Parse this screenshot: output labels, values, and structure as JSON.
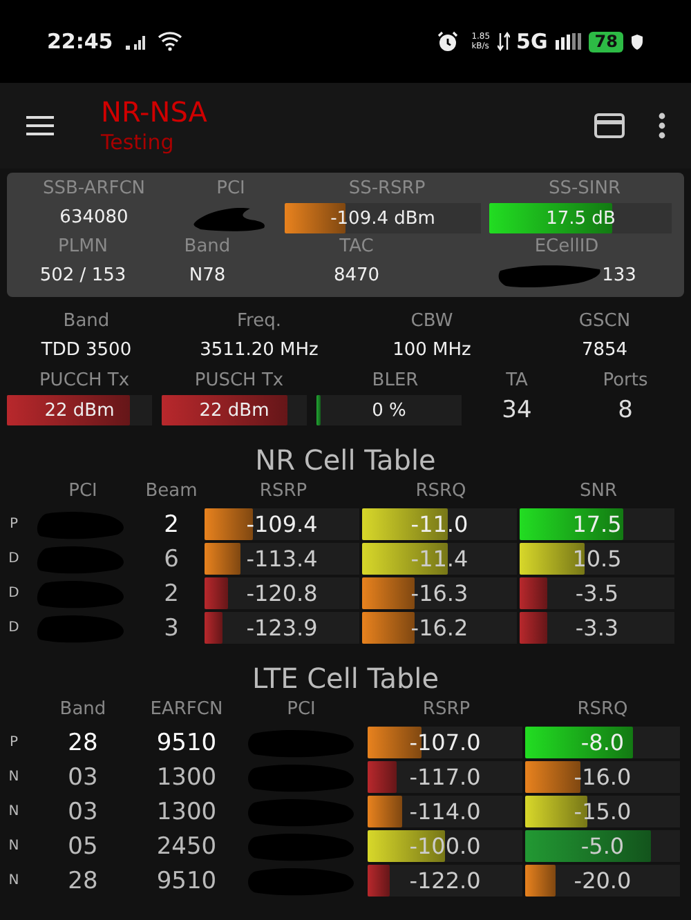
{
  "status_bar": {
    "time": "22:45",
    "net_speed": "1.85",
    "net_unit": "kB/s",
    "network": "5G",
    "battery": "78"
  },
  "app_bar": {
    "title": "NR-NSA",
    "subtitle": "Testing"
  },
  "serving_cell": {
    "row_1": [
      {
        "kind": "text",
        "label": "SSB-ARFCN",
        "value": "634080"
      },
      {
        "kind": "redacted",
        "label": "PCI"
      },
      {
        "kind": "bar",
        "label": "SS-RSRP",
        "value": "-109.4 dBm",
        "level": 0.31,
        "color": "#e8821e"
      },
      {
        "kind": "bar",
        "label": "SS-SINR",
        "value": "17.5 dB",
        "level": 0.67,
        "color": "#22dd22"
      }
    ],
    "row_2": [
      {
        "kind": "text",
        "label": "PLMN",
        "value": "502 / 153"
      },
      {
        "kind": "text",
        "label": "Band",
        "value": "N78"
      },
      {
        "kind": "text",
        "label": "TAC",
        "value": "8470"
      },
      {
        "kind": "partly_redacted",
        "label": "ECellID",
        "value": "133"
      }
    ]
  },
  "carrier": [
    {
      "label": "Band",
      "value": "TDD 3500"
    },
    {
      "label": "Freq.",
      "value": "3511.20 MHz"
    },
    {
      "label": "CBW",
      "value": "100 MHz"
    },
    {
      "label": "GSCN",
      "value": "7854"
    }
  ],
  "uplink": [
    {
      "kind": "bar",
      "label": "PUCCH Tx",
      "value": "22 dBm",
      "level": 0.85,
      "color": "#b8282c"
    },
    {
      "kind": "bar",
      "label": "PUSCH Tx",
      "value": "22 dBm",
      "level": 0.87,
      "color": "#b8282c"
    },
    {
      "kind": "bar",
      "label": "BLER",
      "value": "0 %",
      "level": 0.03,
      "color": "#22aa33"
    },
    {
      "kind": "text",
      "label": "TA",
      "value": "34"
    },
    {
      "kind": "text",
      "label": "Ports",
      "value": "8"
    }
  ],
  "nr_table": {
    "title": "NR Cell Table",
    "columns": [
      "PCI",
      "Beam",
      "RSRP",
      "RSRQ",
      "SNR"
    ],
    "rows": [
      {
        "type": "P",
        "primary": true,
        "pci_redacted": true,
        "beam": "2",
        "bars": [
          {
            "value": "-109.4",
            "level": 0.31,
            "color": "#e8821e"
          },
          {
            "value": "-11.0",
            "level": 0.55,
            "color": "#d8d82a"
          },
          {
            "value": "17.5",
            "level": 0.67,
            "color": "#22dd22"
          }
        ]
      },
      {
        "type": "D",
        "primary": false,
        "pci_redacted": true,
        "beam": "6",
        "bars": [
          {
            "value": "-113.4",
            "level": 0.23,
            "color": "#e8821e"
          },
          {
            "value": "-11.4",
            "level": 0.55,
            "color": "#d8d82a"
          },
          {
            "value": "10.5",
            "level": 0.42,
            "color": "#d8d82a"
          }
        ]
      },
      {
        "type": "D",
        "primary": false,
        "pci_redacted": true,
        "beam": "2",
        "bars": [
          {
            "value": "-120.8",
            "level": 0.15,
            "color": "#b8282c"
          },
          {
            "value": "-16.3",
            "level": 0.34,
            "color": "#e8821e"
          },
          {
            "value": "-3.5",
            "level": 0.18,
            "color": "#b8282c"
          }
        ]
      },
      {
        "type": "D",
        "primary": false,
        "pci_redacted": true,
        "beam": "3",
        "bars": [
          {
            "value": "-123.9",
            "level": 0.12,
            "color": "#b8282c"
          },
          {
            "value": "-16.2",
            "level": 0.34,
            "color": "#e8821e"
          },
          {
            "value": "-3.3",
            "level": 0.18,
            "color": "#b8282c"
          }
        ]
      }
    ]
  },
  "lte_table": {
    "title": "LTE Cell Table",
    "columns": [
      "Band",
      "EARFCN",
      "PCI",
      "RSRP",
      "RSRQ"
    ],
    "rows": [
      {
        "type": "P",
        "primary": true,
        "band": "28",
        "earfcn": "9510",
        "pci_redacted": true,
        "bars": [
          {
            "value": "-107.0",
            "level": 0.35,
            "color": "#e8821e"
          },
          {
            "value": "-8.0",
            "level": 0.7,
            "color": "#22dd22"
          }
        ]
      },
      {
        "type": "N",
        "primary": false,
        "band": "03",
        "earfcn": "1300",
        "pci_redacted": true,
        "bars": [
          {
            "value": "-117.0",
            "level": 0.19,
            "color": "#b8282c"
          },
          {
            "value": "-16.0",
            "level": 0.36,
            "color": "#e8821e"
          }
        ]
      },
      {
        "type": "N",
        "primary": false,
        "band": "03",
        "earfcn": "1300",
        "pci_redacted": true,
        "bars": [
          {
            "value": "-114.0",
            "level": 0.22,
            "color": "#e8821e"
          },
          {
            "value": "-15.0",
            "level": 0.4,
            "color": "#d8d82a"
          }
        ]
      },
      {
        "type": "N",
        "primary": false,
        "band": "05",
        "earfcn": "2450",
        "pci_redacted": true,
        "bars": [
          {
            "value": "-100.0",
            "level": 0.5,
            "color": "#d8d82a"
          },
          {
            "value": "-5.0",
            "level": 0.81,
            "color": "#229933"
          }
        ]
      },
      {
        "type": "N",
        "primary": false,
        "band": "28",
        "earfcn": "9510",
        "pci_redacted": true,
        "bars": [
          {
            "value": "-122.0",
            "level": 0.14,
            "color": "#b8282c"
          },
          {
            "value": "-20.0",
            "level": 0.2,
            "color": "#e8821e"
          }
        ]
      }
    ]
  }
}
